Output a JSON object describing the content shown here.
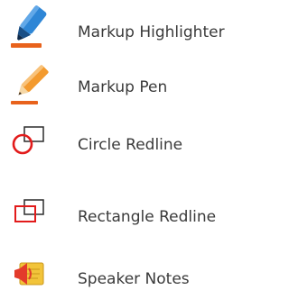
{
  "menu": {
    "items": [
      {
        "label": "Markup Highlighter",
        "icon": "highlighter-icon"
      },
      {
        "label": "Markup Pen",
        "icon": "pen-icon"
      },
      {
        "label": "Circle Redline",
        "icon": "circle-redline-icon"
      },
      {
        "label": "Rectangle Redline",
        "icon": "rectangle-redline-icon"
      },
      {
        "label": "Speaker Notes",
        "icon": "speaker-notes-icon"
      }
    ]
  },
  "colors": {
    "highlighter_body": "#2e86d6",
    "pen_body": "#f39a2e",
    "mark_underline": "#e8621c",
    "redline": "#e21b1b",
    "outline": "#2b2b2b",
    "notes_yellow": "#f2c43a"
  }
}
